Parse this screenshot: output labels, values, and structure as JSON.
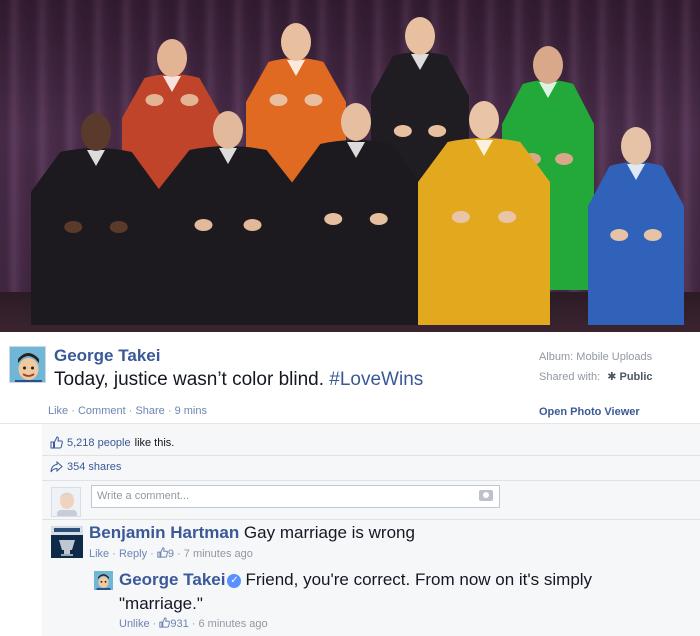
{
  "post": {
    "author": "George Takei",
    "text": "Today, justice wasn’t color blind. ",
    "hashtag": "#LoveWins",
    "actions": {
      "like": "Like",
      "comment": "Comment",
      "share": "Share",
      "time": "9 mins",
      "dot": " · "
    },
    "album": "Album: Mobile Uploads",
    "shared_with_label": "Shared with:",
    "audience": "Public",
    "open_viewer": "Open Photo Viewer"
  },
  "photo": {
    "people": [
      {
        "robe": "#c0442a",
        "skin": "#e3b494"
      },
      {
        "robe": "#e06a22",
        "skin": "#e8c0a0"
      },
      {
        "robe": "#1f1d22",
        "skin": "#e8c0a0"
      },
      {
        "robe": "#23a83a",
        "skin": "#d9a88a"
      },
      {
        "robe": "#1c1a1f",
        "skin": "#5a3a2a"
      },
      {
        "robe": "#1c1a1f",
        "skin": "#e2b99a"
      },
      {
        "robe": "#1c1a1f",
        "skin": "#e6bea0"
      },
      {
        "robe": "#e2a81e",
        "skin": "#eac4a6"
      },
      {
        "robe": "#2f62b8",
        "skin": "#e6c2a6"
      }
    ]
  },
  "ufi": {
    "likes_count": "5,218 people",
    "likes_rest": " like this.",
    "shares": "354 shares",
    "comment_placeholder": "Write a comment...",
    "comments": [
      {
        "author": "Benjamin Hartman",
        "text": " Gay marriage is wrong",
        "like": "Like",
        "reply": "Reply",
        "likes": "9",
        "time": "7 minutes ago"
      },
      {
        "author": "George Takei",
        "text": "Friend,  you're correct.  From now on it's simply \"marriage.\"",
        "unlike": "Unlike",
        "likes": "931",
        "time": "6 minutes ago"
      }
    ]
  },
  "colors": {
    "link": "#3b5998",
    "meta": "#9197a3",
    "ufi_bg": "#f6f7f9",
    "verified": "#5890ff"
  },
  "icons": [
    "thumbs-up-icon",
    "share-arrow-icon",
    "gear-icon",
    "camera-icon",
    "verified-badge-icon"
  ]
}
